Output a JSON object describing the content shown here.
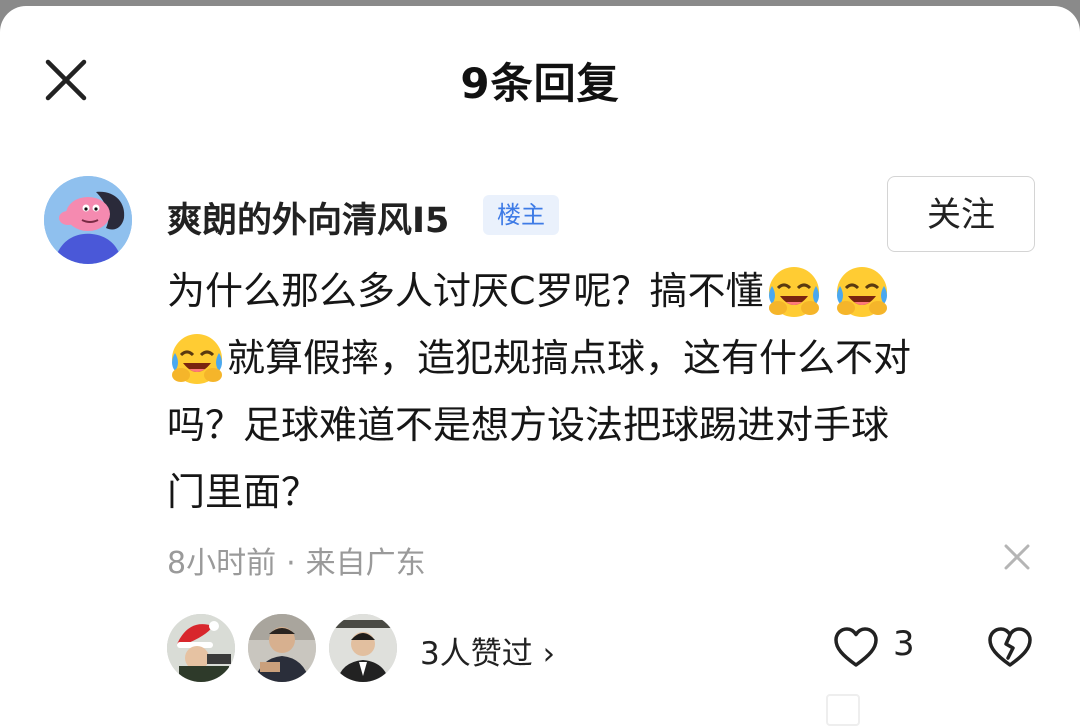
{
  "header": {
    "title": "9条回复"
  },
  "comment": {
    "username": "爽朗的外向清风I5",
    "op_badge": "楼主",
    "follow_label": "关注",
    "text_line1": "为什么那么多人讨厌C罗呢？搞不懂",
    "text_line2": "就算假摔，造犯规搞点球，这有什么不对",
    "text_line3": "吗？足球难道不是想方设法把球踢进对手球",
    "text_line4": "门里面？",
    "emoji": "laughing-crying-emoji",
    "time": "8小时前",
    "separator": "·",
    "location": "来自广东",
    "likes_summary": "3人赞过",
    "likes_chevron": "›",
    "like_count": "3"
  },
  "colors": {
    "badge_text": "#3e7be6",
    "badge_bg": "#eaf1fc",
    "meta_text": "#9a9a9a",
    "avatar_bg": "#8fc0ee"
  },
  "icons": [
    "close-icon",
    "dismiss-icon",
    "heart-icon",
    "broken-heart-icon"
  ]
}
